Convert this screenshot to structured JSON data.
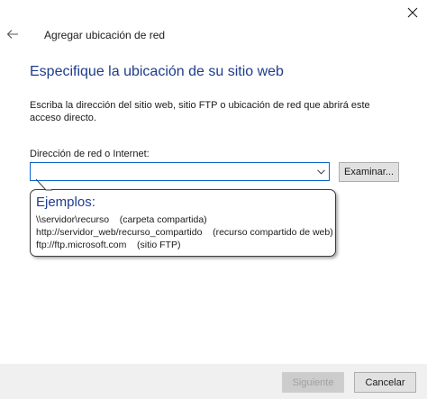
{
  "window": {
    "title": "Agregar ubicación de red",
    "back_icon": "back-arrow-icon",
    "close_icon": "close-icon"
  },
  "main": {
    "heading": "Especifique la ubicación de su sitio web",
    "description": "Escriba la dirección del sitio web, sitio FTP o ubicación de red que abrirá este acceso directo.",
    "address_label": "Dirección de red o Internet:",
    "address_value": "",
    "browse_label": "Examinar..."
  },
  "examples_tooltip": {
    "title": "Ejemplos:",
    "lines": [
      "\\\\servidor\\recurso    (carpeta compartida)",
      "http://servidor_web/recurso_compartido    (recurso compartido de web)",
      "ftp://ftp.microsoft.com    (sitio FTP)"
    ]
  },
  "footer": {
    "next_label": "Siguiente",
    "cancel_label": "Cancelar"
  },
  "colors": {
    "heading": "#1e3c8c",
    "focus_border": "#0a64c8",
    "footer_bg": "#f0f0f0"
  }
}
